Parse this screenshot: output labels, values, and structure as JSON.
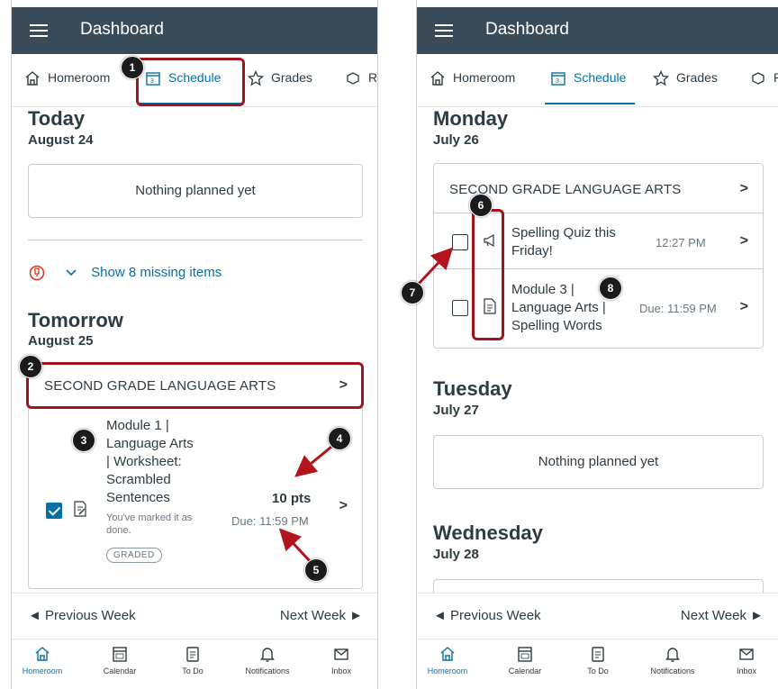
{
  "left": {
    "app_title": "Dashboard",
    "tabs": [
      "Homeroom",
      "Schedule",
      "Grades",
      "R"
    ],
    "today": {
      "title": "Today",
      "date": "August 24",
      "nothing": "Nothing planned yet"
    },
    "missing": "Show 8 missing items",
    "tomorrow": {
      "title": "Tomorrow",
      "date": "August 25",
      "course": "SECOND GRADE LANGUAGE ARTS",
      "item": {
        "title_lines": [
          "Module 1 |",
          "Language Arts",
          "| Worksheet:",
          "Scrambled",
          "Sentences"
        ],
        "done_lines": [
          "You've marked it as",
          "done."
        ],
        "pts": "10 pts",
        "due": "Due: 11:59 PM",
        "badge": "GRADED",
        "checked": true
      }
    },
    "week_nav": {
      "prev": "◄ Previous Week",
      "next": "Next Week ►"
    },
    "bottom_nav": [
      "Homeroom",
      "Calendar",
      "To Do",
      "Notifications",
      "Inbox"
    ]
  },
  "right": {
    "app_title": "Dashboard",
    "tabs": [
      "Homeroom",
      "Schedule",
      "Grades",
      "R"
    ],
    "monday": {
      "title": "Monday",
      "date": "July 26",
      "course": "SECOND GRADE LANGUAGE ARTS",
      "items": [
        {
          "title_lines": [
            "Spelling Quiz this",
            "Friday!"
          ],
          "time": "12:27 PM",
          "icon": "announcement-icon"
        },
        {
          "title_lines": [
            "Module 3 |",
            "Language Arts |",
            "Spelling Words"
          ],
          "time": "Due: 11:59 PM",
          "icon": "assignment-icon"
        }
      ]
    },
    "tuesday": {
      "title": "Tuesday",
      "date": "July 27",
      "nothing": "Nothing planned yet"
    },
    "wednesday": {
      "title": "Wednesday",
      "date": "July 28"
    },
    "week_nav": {
      "prev": "◄ Previous Week",
      "next": "Next Week ►"
    },
    "bottom_nav": [
      "Homeroom",
      "Calendar",
      "To Do",
      "Notifications",
      "Inbox"
    ]
  },
  "annotations": [
    "1",
    "2",
    "3",
    "4",
    "5",
    "6",
    "7",
    "8"
  ],
  "colors": {
    "appbar": "#394b58",
    "accent": "#0770a3",
    "highlight": "#a0141d",
    "missing_icon": "#e0301e"
  }
}
